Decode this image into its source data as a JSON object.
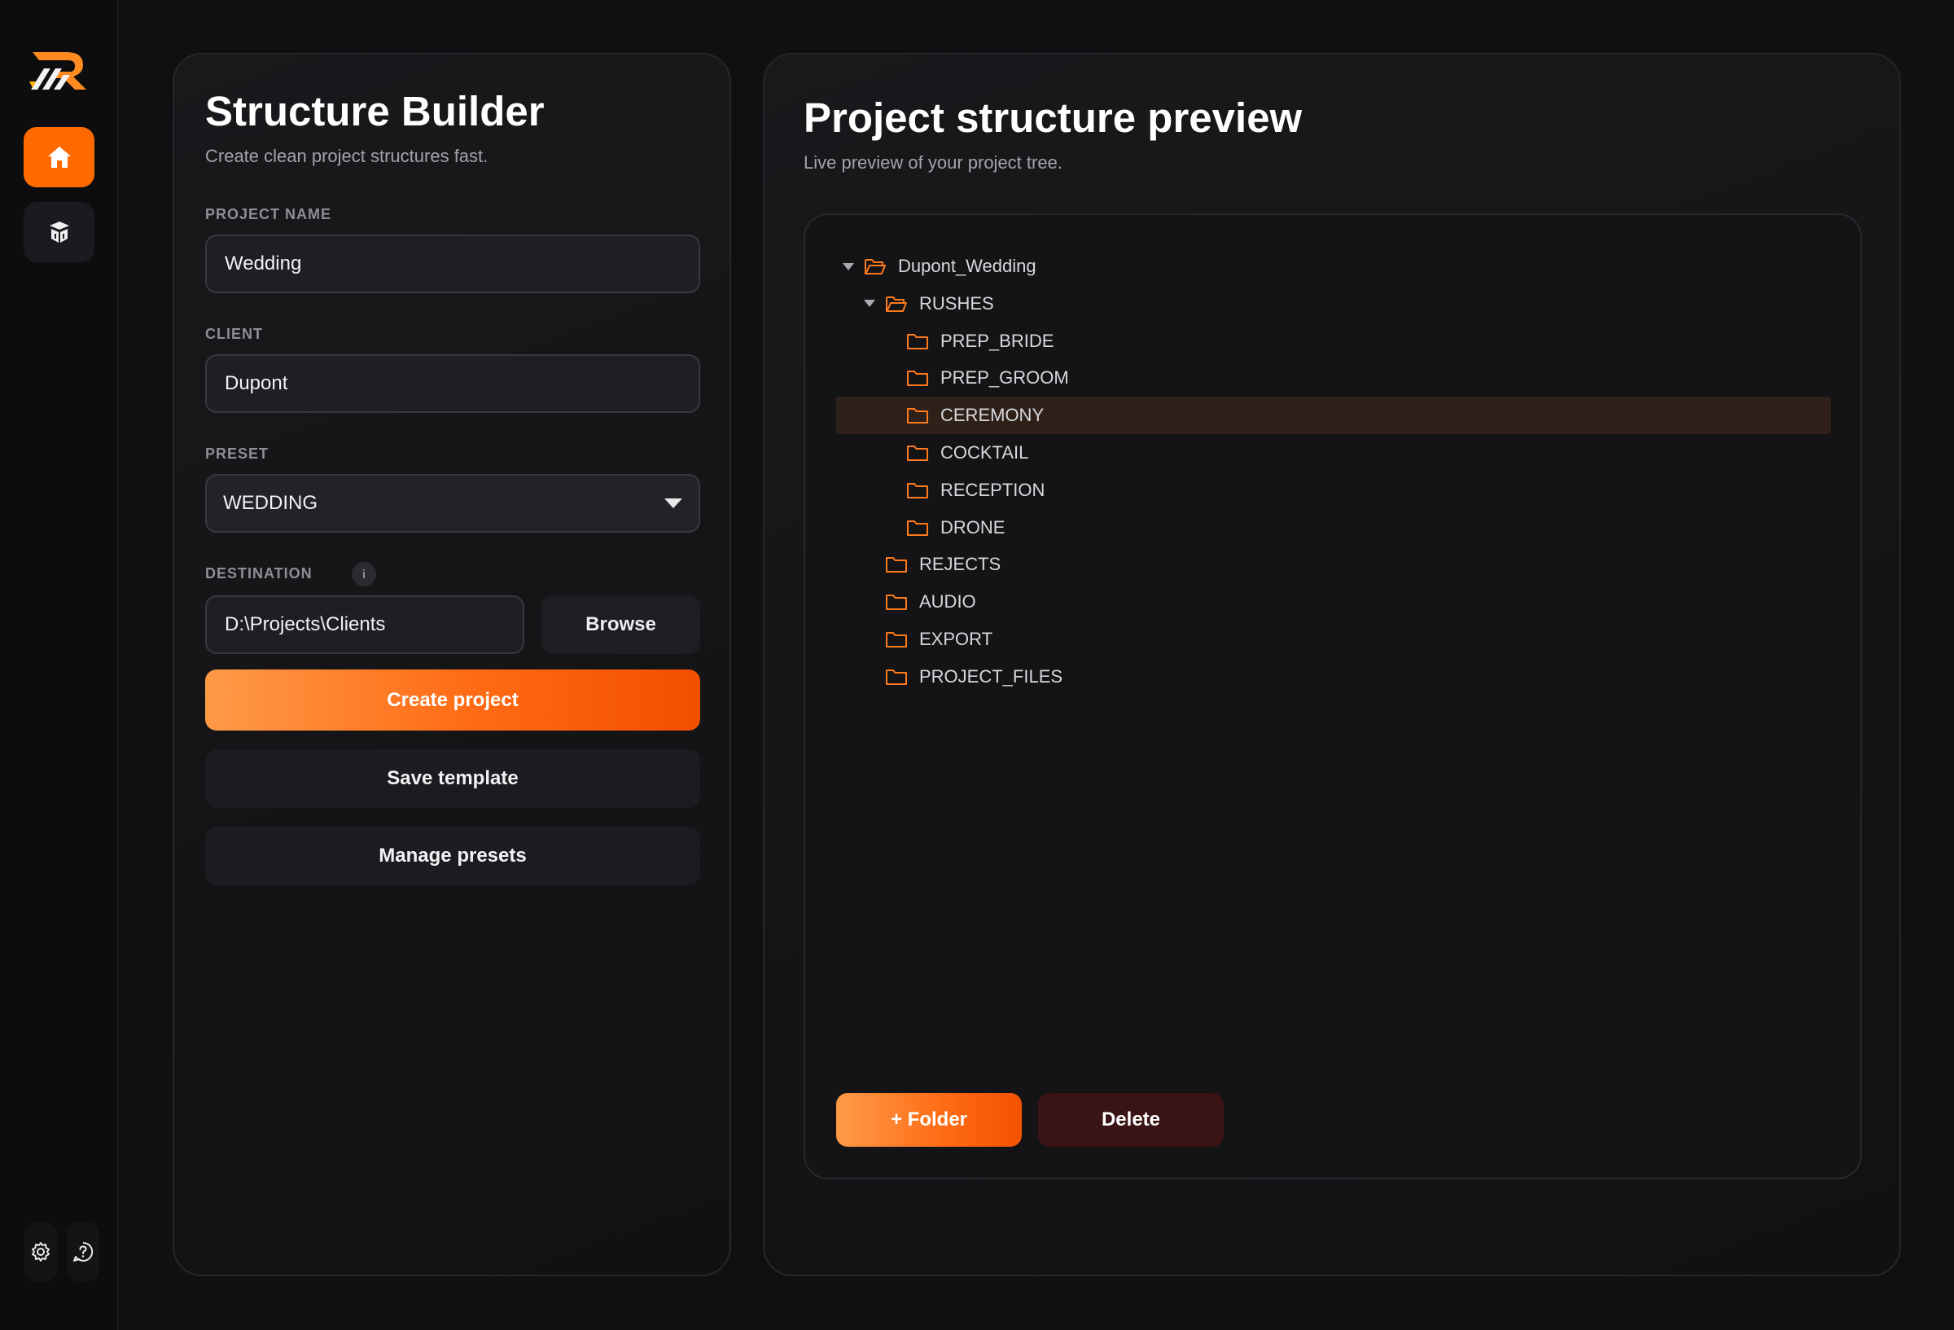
{
  "sidebar": {
    "logo": "app-logo",
    "nav": [
      {
        "id": "home",
        "icon": "home-icon",
        "active": true
      },
      {
        "id": "packages",
        "icon": "package-icon",
        "active": false
      }
    ],
    "footer": [
      {
        "id": "settings",
        "icon": "gear-icon"
      },
      {
        "id": "help",
        "icon": "help-icon"
      }
    ]
  },
  "builder": {
    "title": "Structure Builder",
    "subtitle": "Create clean project structures fast.",
    "project_name_label": "PROJECT NAME",
    "project_name_value": "Wedding",
    "client_label": "CLIENT",
    "client_value": "Dupont",
    "preset_label": "PRESET",
    "preset_value": "WEDDING",
    "destination_label": "DESTINATION",
    "destination_info": "i",
    "destination_value": "D:\\Projects\\Clients",
    "browse_label": "Browse",
    "create_label": "Create project",
    "save_template_label": "Save template",
    "manage_presets_label": "Manage presets"
  },
  "preview": {
    "title": "Project structure preview",
    "subtitle": "Live preview of your project tree.",
    "tree": [
      {
        "label": "Dupont_Wedding",
        "depth": 0,
        "expandable": true,
        "open": true,
        "selected": false
      },
      {
        "label": "RUSHES",
        "depth": 1,
        "expandable": true,
        "open": true,
        "selected": false
      },
      {
        "label": "PREP_BRIDE",
        "depth": 2,
        "expandable": false,
        "open": false,
        "selected": false
      },
      {
        "label": "PREP_GROOM",
        "depth": 2,
        "expandable": false,
        "open": false,
        "selected": false
      },
      {
        "label": "CEREMONY",
        "depth": 2,
        "expandable": false,
        "open": false,
        "selected": true
      },
      {
        "label": "COCKTAIL",
        "depth": 2,
        "expandable": false,
        "open": false,
        "selected": false
      },
      {
        "label": "RECEPTION",
        "depth": 2,
        "expandable": false,
        "open": false,
        "selected": false
      },
      {
        "label": "DRONE",
        "depth": 2,
        "expandable": false,
        "open": false,
        "selected": false
      },
      {
        "label": "REJECTS",
        "depth": 1,
        "expandable": false,
        "open": false,
        "selected": false
      },
      {
        "label": "AUDIO",
        "depth": 1,
        "expandable": false,
        "open": false,
        "selected": false
      },
      {
        "label": "EXPORT",
        "depth": 1,
        "expandable": false,
        "open": false,
        "selected": false
      },
      {
        "label": "PROJECT_FILES",
        "depth": 1,
        "expandable": false,
        "open": false,
        "selected": false
      }
    ],
    "add_folder_label": "+ Folder",
    "delete_label": "Delete"
  },
  "colors": {
    "accent": "#ff6a00",
    "accent_light": "#ff9a48",
    "danger_bg": "#3a1414",
    "selected_row": "#2f2019",
    "panel_bg": "#19191c",
    "folder_icon": "#ff7a1a"
  }
}
